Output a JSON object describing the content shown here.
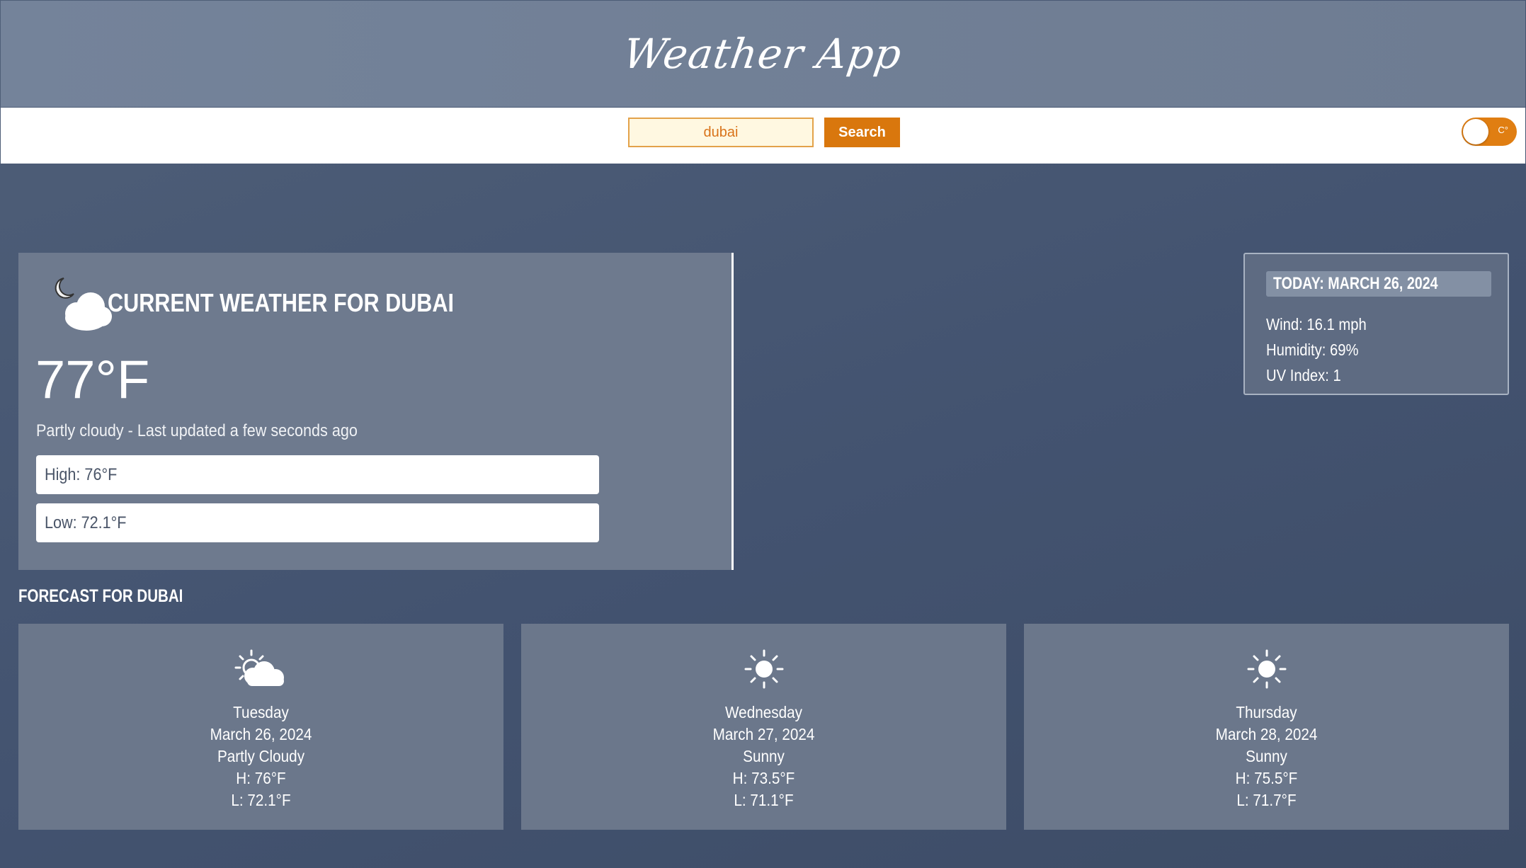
{
  "header": {
    "title": "Weather App"
  },
  "search": {
    "value": "dubai",
    "button_label": "Search"
  },
  "unit_toggle": {
    "label": "C°"
  },
  "current": {
    "icon": "night-partly-cloudy-icon",
    "title": "CURRENT WEATHER FOR DUBAI",
    "temperature": "77°F",
    "description": "Partly cloudy - Last updated a few seconds ago",
    "high": "High: 76°F",
    "low": "Low: 72.1°F"
  },
  "today": {
    "header": "TODAY: MARCH 26, 2024",
    "wind": "Wind: 16.1 mph",
    "humidity": "Humidity: 69%",
    "uv": "UV Index: 1"
  },
  "forecast": {
    "heading": "FORECAST FOR DUBAI",
    "days": [
      {
        "icon": "partly-cloudy-icon",
        "day": "Tuesday",
        "date": "March 26, 2024",
        "condition": "Partly Cloudy",
        "high": "H: 76°F",
        "low": "L: 72.1°F"
      },
      {
        "icon": "sunny-icon",
        "day": "Wednesday",
        "date": "March 27, 2024",
        "condition": "Sunny",
        "high": "H: 73.5°F",
        "low": "L: 71.1°F"
      },
      {
        "icon": "sunny-icon",
        "day": "Thursday",
        "date": "March 28, 2024",
        "condition": "Sunny",
        "high": "H: 75.5°F",
        "low": "L: 71.7°F"
      }
    ]
  },
  "colors": {
    "accent": "#d9770d",
    "background": "#435370",
    "card": "#6e7a8e"
  }
}
